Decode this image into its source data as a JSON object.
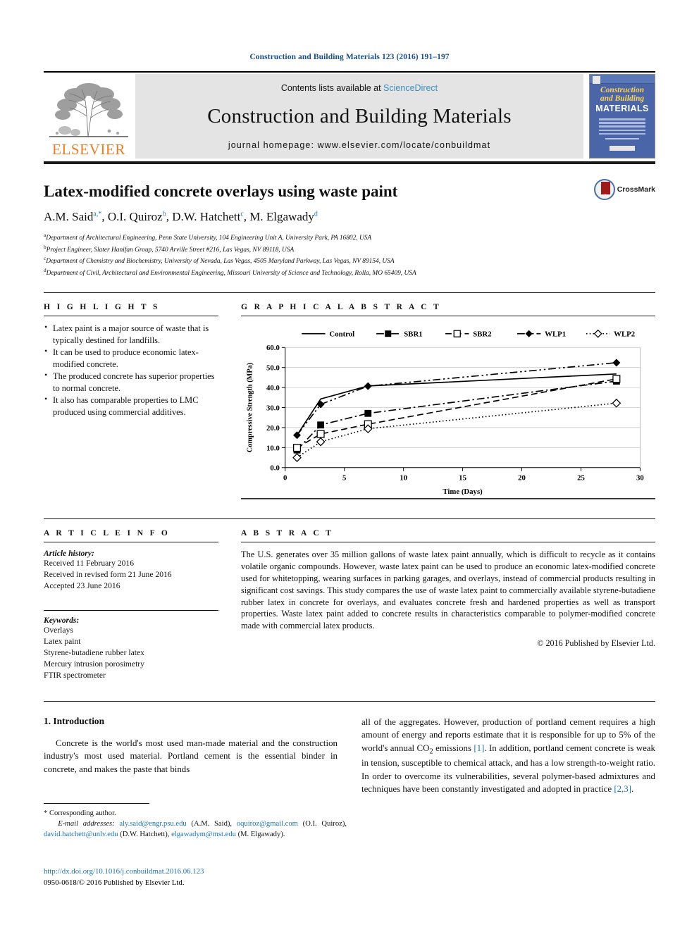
{
  "running_head": "Construction and Building Materials 123 (2016) 191–197",
  "masthead": {
    "contents_prefix": "Contents lists available at ",
    "sciencedirect": "ScienceDirect",
    "journal_title": "Construction and Building Materials",
    "homepage": "journal homepage: www.elsevier.com/locate/conbuildmat",
    "publisher": "ELSEVIER",
    "cover": {
      "line1": "Construction",
      "line2": "and Building",
      "line3": "MATERIALS"
    }
  },
  "article": {
    "title": "Latex-modified concrete overlays using waste paint",
    "authors": [
      {
        "name": "A.M. Said",
        "sup": "a,*"
      },
      {
        "name": "O.I. Quiroz",
        "sup": "b"
      },
      {
        "name": "D.W. Hatchett",
        "sup": "c"
      },
      {
        "name": "M. Elgawady",
        "sup": "d"
      }
    ],
    "affiliations": [
      {
        "mark": "a",
        "text": "Department of Architectural Engineering, Penn State University, 104 Engineering Unit A, University Park, PA 16802, USA"
      },
      {
        "mark": "b",
        "text": "Project Engineer, Slater Hanifan Group, 5740 Arville Street #216, Las Vegas, NV 89118, USA"
      },
      {
        "mark": "c",
        "text": "Department of Chemistry and Biochemistry, University of Nevada, Las Vegas, 4505 Maryland Parkway, Las Vegas, NV 89154, USA"
      },
      {
        "mark": "d",
        "text": "Department of Civil, Architectural and Environmental Engineering, Missouri University of Science and Technology, Rolla, MO 65409, USA"
      }
    ],
    "crossmark_label": "CrossMark"
  },
  "highlights": {
    "heading": "H I G H L I G H T S",
    "items": [
      "Latex paint is a major source of waste that is typically destined for landfills.",
      "It can be used to produce economic latex-modified concrete.",
      "The produced concrete has superior properties to normal concrete.",
      "It also has comparable properties to LMC produced using commercial additives."
    ]
  },
  "graphical_abstract": {
    "heading": "G R A P H I C A L   A B S T R A C T"
  },
  "article_info": {
    "heading": "A R T I C L E   I N F O",
    "history_label": "Article history:",
    "history": [
      "Received 11 February 2016",
      "Received in revised form 21 June 2016",
      "Accepted 23 June 2016"
    ],
    "keywords_label": "Keywords:",
    "keywords": [
      "Overlays",
      "Latex paint",
      "Styrene-butadiene rubber latex",
      "Mercury intrusion porosimetry",
      "FTIR spectrometer"
    ]
  },
  "abstract": {
    "heading": "A B S T R A C T",
    "text": "The U.S. generates over 35 million gallons of waste latex paint annually, which is difficult to recycle as it contains volatile organic compounds. However, waste latex paint can be used to produce an economic latex-modified concrete used for whitetopping, wearing surfaces in parking garages, and overlays, instead of commercial products resulting in significant cost savings. This study compares the use of waste latex paint to commercially available styrene-butadiene rubber latex in concrete for overlays, and evaluates concrete fresh and hardened properties as well as transport properties. Waste latex paint added to concrete results in characteristics comparable to polymer-modified concrete made with commercial latex products.",
    "copyright": "© 2016 Published by Elsevier Ltd."
  },
  "body": {
    "section_heading": "1. Introduction",
    "col1_text": "Concrete is the world's most used man-made material and the construction industry's most used material. Portland cement is the essential binder in concrete, and makes the paste that binds",
    "col2_part1": "all of the aggregates. However, production of portland cement requires a high amount of energy and reports estimate that it is responsible for up to 5% of the world's annual CO",
    "col2_sub": "2",
    "col2_part2": " emissions ",
    "col2_ref1": "[1]",
    "col2_part3": ". In addition, portland cement concrete is weak in tension, susceptible to chemical attack, and has a low strength-to-weight ratio. In order to overcome its vulnerabilities, several polymer-based admixtures and techniques have been constantly investigated and adopted in practice ",
    "col2_ref2": "[2,3]",
    "col2_part4": "."
  },
  "footnotes": {
    "corresponding": "* Corresponding author.",
    "email_label": "E-mail addresses:",
    "emails": [
      {
        "addr": "aly.said@engr.psu.edu",
        "who": "(A.M. Said),"
      },
      {
        "addr": "oquiroz@gmail.com",
        "who": "(O.I. Quiroz),"
      },
      {
        "addr": "david.hatchett@unlv.edu",
        "who": "(D.W. Hatchett),"
      },
      {
        "addr": "elgawadym@mst.edu",
        "who": "(M. Elgawady)."
      }
    ],
    "doi": "http://dx.doi.org/10.1016/j.conbuildmat.2016.06.123",
    "issn": "0950-0618/© 2016 Published by Elsevier Ltd."
  },
  "chart_data": {
    "type": "line",
    "title": "",
    "xlabel": "Time (Days)",
    "ylabel": "Compressive Strength (MPa)",
    "xlim": [
      0,
      30
    ],
    "ylim": [
      0,
      60
    ],
    "xticks": [
      0,
      5,
      10,
      15,
      20,
      25,
      30
    ],
    "yticks": [
      "0.0",
      "10.0",
      "20.0",
      "30.0",
      "40.0",
      "50.0",
      "60.0"
    ],
    "grid": true,
    "legend_position": "top",
    "x": [
      1,
      3,
      7,
      28
    ],
    "series": [
      {
        "name": "Control",
        "values": [
          16.2,
          34.3,
          40.8,
          46.8
        ],
        "marker": "none",
        "dash": "solid"
      },
      {
        "name": "SBR1",
        "values": [
          8.8,
          21.3,
          27.1,
          43.2
        ],
        "marker": "filled-square",
        "dash": "dashdot"
      },
      {
        "name": "SBR2",
        "values": [
          9.9,
          16.8,
          21.7,
          44.3
        ],
        "marker": "open-square",
        "dash": "dashed"
      },
      {
        "name": "WLP1",
        "values": [
          16.2,
          31.6,
          40.7,
          52.4
        ],
        "marker": "filled-diamond",
        "dash": "dashdotdot"
      },
      {
        "name": "WLP2",
        "values": [
          5.0,
          12.9,
          19.4,
          32.2
        ],
        "marker": "open-diamond",
        "dash": "dotted"
      }
    ]
  }
}
